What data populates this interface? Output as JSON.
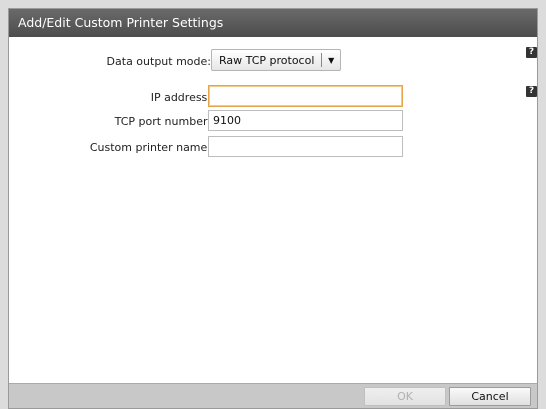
{
  "dialog": {
    "title": "Add/Edit Custom Printer Settings"
  },
  "form": {
    "output_mode_label": "Data output mode:",
    "output_mode_value": "Raw TCP protocol",
    "ip_label": "IP address:",
    "ip_value": "",
    "port_label": "TCP port number:",
    "port_value": "9100",
    "name_label": "Custom printer name:",
    "name_value": ""
  },
  "help": {
    "glyph": "?"
  },
  "footer": {
    "ok_label": "OK",
    "cancel_label": "Cancel"
  }
}
